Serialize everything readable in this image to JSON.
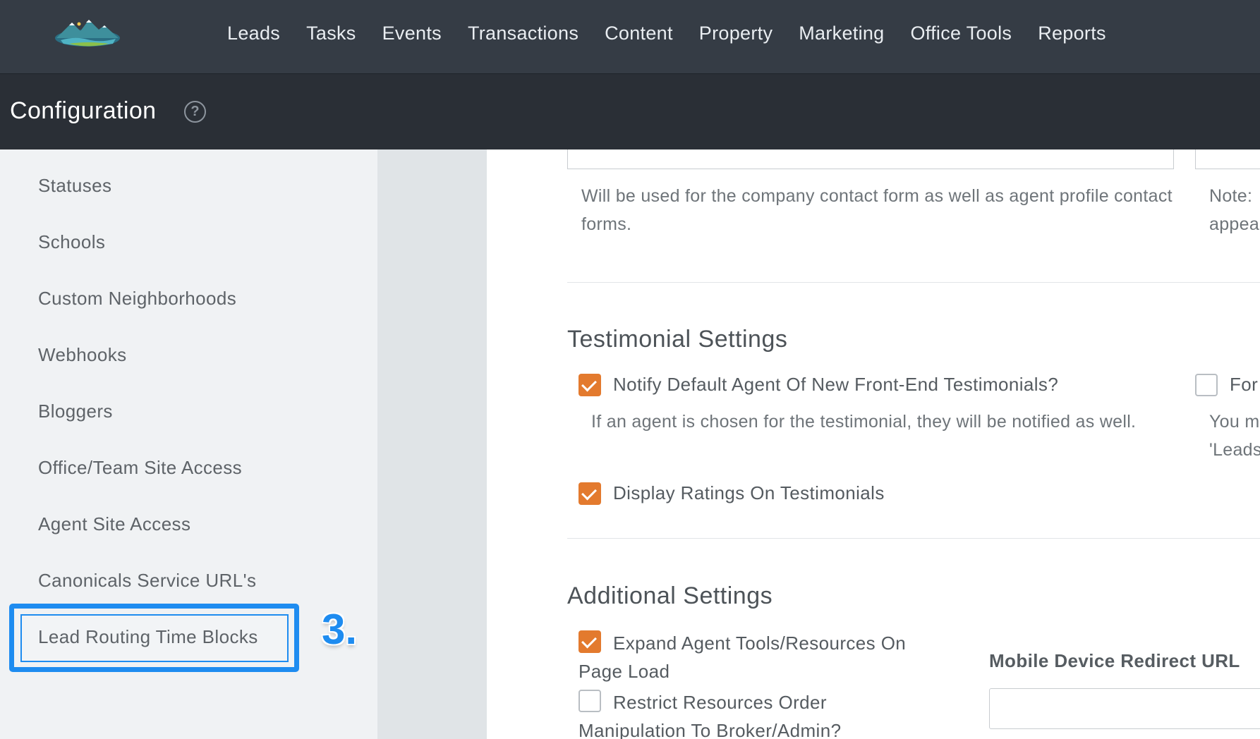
{
  "nav": {
    "logo": "mountain-lake-logo",
    "items": [
      "Leads",
      "Tasks",
      "Events",
      "Transactions",
      "Content",
      "Property",
      "Marketing",
      "Office Tools",
      "Reports"
    ]
  },
  "header": {
    "title": "Configuration",
    "help_icon": "?"
  },
  "sidebar": {
    "items": [
      "Statuses",
      "Schools",
      "Custom Neighborhoods",
      "Webhooks",
      "Bloggers",
      "Office/Team Site Access",
      "Agent Site Access",
      "Canonicals Service URL's",
      "Lead Routing Time Blocks"
    ],
    "highlighted": "Lead Routing Time Blocks",
    "step_marker": "3."
  },
  "content": {
    "contact_help": "Will be used for the company contact form as well as agent profile contact forms.",
    "note_clipped_line1": "Note:",
    "note_clipped_line2": "appea",
    "testimonial": {
      "title": "Testimonial Settings",
      "notify_label": "Notify Default Agent Of New Front-End Testimonials?",
      "notify_checked": true,
      "notify_help": "If an agent is chosen for the testimonial, they will be notified as well.",
      "right_clipped_label": "For",
      "right_clipped_help_line1": "You m",
      "right_clipped_help_line2": "'Leads",
      "display_ratings_label": "Display Ratings On Testimonials",
      "display_ratings_checked": true
    },
    "additional": {
      "title": "Additional Settings",
      "expand_label": "Expand Agent Tools/Resources On Page Load",
      "expand_checked": true,
      "restrict_label": "Restrict Resources Order Manipulation To Broker/Admin?",
      "restrict_checked": false,
      "mobile_redirect_label": "Mobile Device Redirect URL",
      "mobile_redirect_value": ""
    }
  },
  "colors": {
    "topbar": "#353c45",
    "confbar": "#2a2f36",
    "sidebar": "#f0f2f4",
    "highlight": "#1e8cf0",
    "checkbox": "#e37a2e"
  }
}
